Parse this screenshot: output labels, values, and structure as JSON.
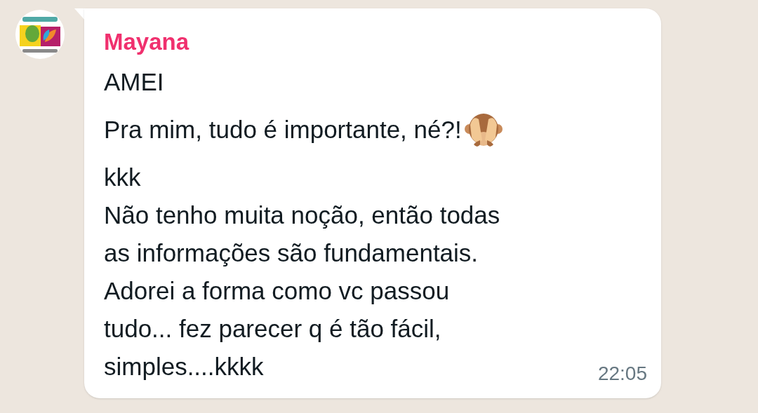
{
  "message": {
    "sender": "Mayana",
    "lines": [
      "AMEI",
      "Pra mim, tudo é importante, né?!",
      "kkk",
      "Não tenho muita noção, então todas",
      "as informações são fundamentais.",
      "Adorei a forma como vc passou",
      "tudo... fez parecer q é tão fácil,",
      "simples....kkkk"
    ],
    "time": "22:05"
  }
}
